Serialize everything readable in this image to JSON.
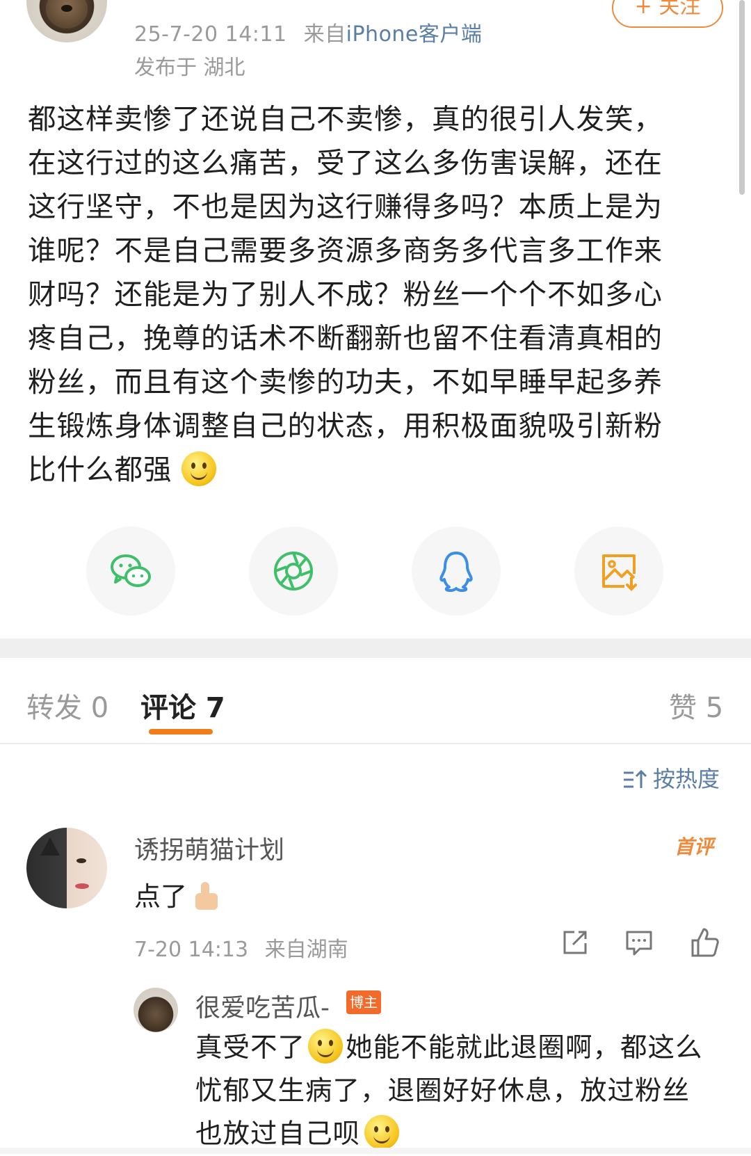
{
  "post": {
    "meta_time": "25-7-20 14:11",
    "meta_from": "来自",
    "meta_client": "iPhone客户端",
    "location": "发布于 湖北",
    "follow_label": "+ 关注",
    "body_lines": [
      "都这样卖惨了还说自己不卖惨，真的很引人发笑，",
      "在这行过的这么痛苦，受了这么多伤害误解，还在",
      "这行坚守，不也是因为这行赚得多吗？本质上是为",
      "谁呢？不是自己需要多资源多商务多代言多工作来",
      "财吗？还能是为了别人不成？粉丝一个个不如多心",
      "疼自己，挽尊的话术不断翻新也留不住看清真相的",
      "粉丝，而且有这个卖惨的功夫，不如早睡早起多养",
      "生锻炼身体调整自己的状态，用积极面貌吸引新粉",
      "比什么都强"
    ]
  },
  "share": [
    {
      "icon": "wechat-icon",
      "color": "#3fbf6a"
    },
    {
      "icon": "moments-icon",
      "color": "#3fbf6a"
    },
    {
      "icon": "qq-icon",
      "color": "#3a8ee6"
    },
    {
      "icon": "save-image-icon",
      "color": "#f0a020"
    }
  ],
  "tabs": {
    "repost": "转发 0",
    "comment": "评论 7",
    "like": "赞 5"
  },
  "sort_label": "按热度",
  "comment": {
    "name": "诱拐萌猫计划",
    "badge": "首评",
    "text": "点了",
    "time": "7-20 14:13",
    "from": "来自湖南"
  },
  "reply": {
    "name": "很爱吃苦瓜-",
    "badge": "博主",
    "line1_a": "真受不了",
    "line1_b": "她能不能就此退圈啊，都这么",
    "line2": "忧郁又生病了，退圈好好休息，放过粉丝",
    "line3": "也放过自己呗"
  },
  "colors": {
    "accent": "#f07c1a",
    "link": "#5b7ea6",
    "meta": "#9a9a9a"
  }
}
